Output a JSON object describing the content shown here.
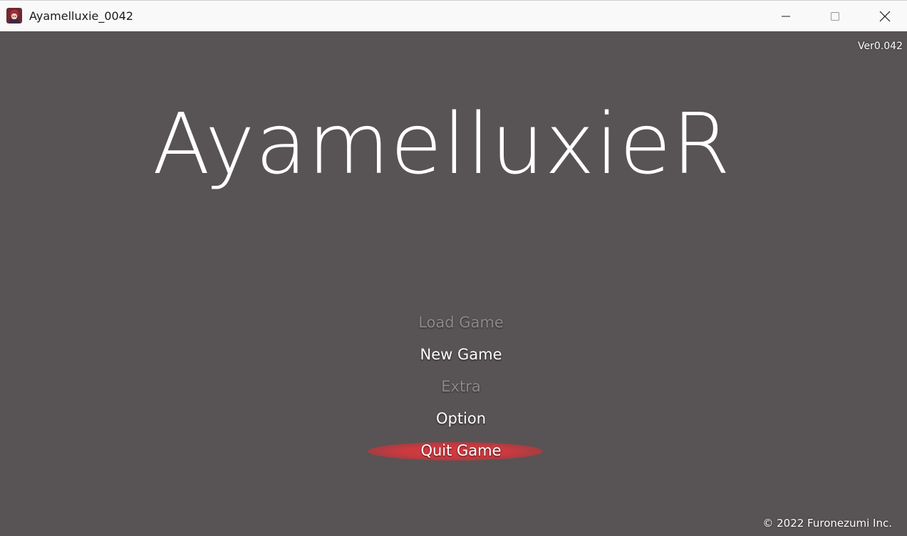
{
  "window": {
    "title": "Ayamelluxie_0042",
    "app_icon": "character-portrait-icon",
    "controls": {
      "minimize_icon": "minimize-icon",
      "maximize_icon": "maximize-icon",
      "close_icon": "close-icon"
    }
  },
  "game": {
    "version": "Ver0.042",
    "logo": "AyamelluxieR",
    "menu": [
      {
        "label": "Load Game",
        "enabled": false,
        "selected": false
      },
      {
        "label": "New Game",
        "enabled": true,
        "selected": false
      },
      {
        "label": "Extra",
        "enabled": false,
        "selected": false
      },
      {
        "label": "Option",
        "enabled": true,
        "selected": false
      },
      {
        "label": "Quit Game",
        "enabled": true,
        "selected": true
      }
    ],
    "copyright": "© 2022 Furonezumi Inc."
  },
  "colors": {
    "background": "#585354",
    "selection": "#c93a40",
    "text": "#ffffff",
    "disabled_text": "#8c8889"
  }
}
